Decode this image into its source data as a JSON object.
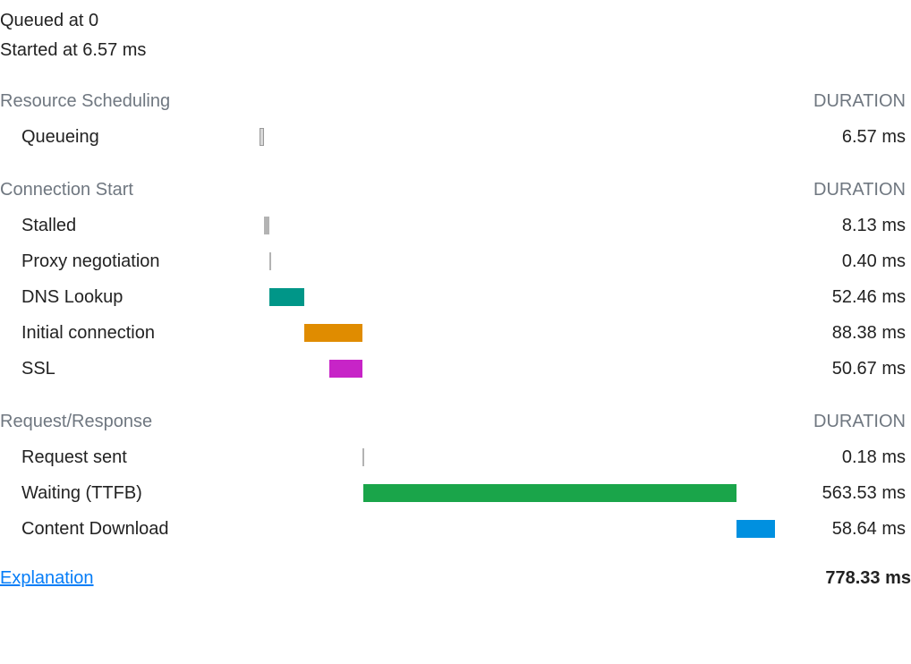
{
  "chart_data": {
    "type": "bar",
    "title": "",
    "xlabel": "",
    "ylabel": "",
    "xlim": [
      0,
      778.33
    ],
    "unit": "ms",
    "series": [
      {
        "name": "Queueing",
        "start": 0,
        "duration": 6.57,
        "color": "#d8d8d8",
        "border": "#999"
      },
      {
        "name": "Stalled",
        "start": 6.57,
        "duration": 8.13,
        "color": "#b3b3b3"
      },
      {
        "name": "Proxy negotiation",
        "start": 14.7,
        "duration": 0.4,
        "color": "#b3b3b3"
      },
      {
        "name": "DNS Lookup",
        "start": 15.1,
        "duration": 52.46,
        "color": "#009688"
      },
      {
        "name": "Initial connection",
        "start": 67.56,
        "duration": 88.38,
        "color": "#e08c00"
      },
      {
        "name": "SSL",
        "start": 105.27,
        "duration": 50.67,
        "color": "#c724c7"
      },
      {
        "name": "Request sent",
        "start": 155.98,
        "duration": 0.18,
        "color": "#b3b3b3"
      },
      {
        "name": "Waiting (TTFB)",
        "start": 156.12,
        "duration": 563.53,
        "color": "#1aa54a"
      },
      {
        "name": "Content Download",
        "start": 719.65,
        "duration": 58.64,
        "color": "#0090e0"
      }
    ]
  },
  "top": {
    "queued": "Queued at 0",
    "started": "Started at 6.57 ms"
  },
  "headers": {
    "duration": "DURATION"
  },
  "sections": [
    {
      "title": "Resource Scheduling",
      "rows": [
        {
          "label": "Queueing",
          "value": "6.57 ms",
          "start": 0,
          "duration": 6.57,
          "color": "#d8d8d8",
          "border": "#999"
        }
      ]
    },
    {
      "title": "Connection Start",
      "rows": [
        {
          "label": "Stalled",
          "value": "8.13 ms",
          "start": 6.57,
          "duration": 8.13,
          "color": "#b3b3b3"
        },
        {
          "label": "Proxy negotiation",
          "value": "0.40 ms",
          "start": 14.7,
          "duration": 0.4,
          "color": "#b3b3b3"
        },
        {
          "label": "DNS Lookup",
          "value": "52.46 ms",
          "start": 15.1,
          "duration": 52.46,
          "color": "#009688"
        },
        {
          "label": "Initial connection",
          "value": "88.38 ms",
          "start": 67.56,
          "duration": 88.38,
          "color": "#e08c00"
        },
        {
          "label": "SSL",
          "value": "50.67 ms",
          "start": 105.27,
          "duration": 50.67,
          "color": "#c724c7"
        }
      ]
    },
    {
      "title": "Request/Response",
      "rows": [
        {
          "label": "Request sent",
          "value": "0.18 ms",
          "start": 155.98,
          "duration": 0.18,
          "color": "#b3b3b3"
        },
        {
          "label": "Waiting (TTFB)",
          "value": "563.53 ms",
          "start": 156.12,
          "duration": 563.53,
          "color": "#1aa54a"
        },
        {
          "label": "Content Download",
          "value": "58.64 ms",
          "start": 719.65,
          "duration": 58.64,
          "color": "#0090e0"
        }
      ]
    }
  ],
  "footer": {
    "explanation": "Explanation",
    "total": "778.33 ms"
  },
  "scale_total_ms": 778.33
}
